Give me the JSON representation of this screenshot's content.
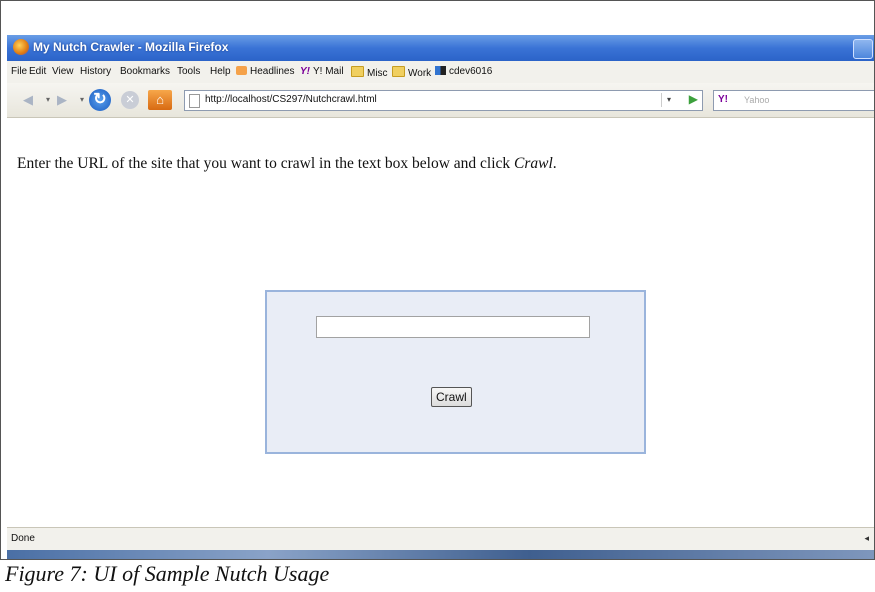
{
  "window": {
    "title": "My Nutch Crawler - Mozilla Firefox"
  },
  "menu": {
    "items": [
      {
        "label": "File"
      },
      {
        "label": "Edit"
      },
      {
        "label": "View"
      },
      {
        "label": "History"
      },
      {
        "label": "Bookmarks"
      },
      {
        "label": "Tools"
      },
      {
        "label": "Help"
      }
    ],
    "bookmarks": [
      {
        "label": "Headlines",
        "icon": "rss-icon"
      },
      {
        "label": "Y! Mail",
        "icon": "yahoo-mail-icon"
      },
      {
        "label": "Misc",
        "icon": "folder-icon"
      },
      {
        "label": "Work",
        "icon": "folder-icon"
      },
      {
        "label": "cdev6016",
        "icon": "delicious-icon"
      }
    ]
  },
  "navigation": {
    "url": "http://localhost/CS297/Nutchcrawl.html",
    "search_engine_label": "Y!",
    "search_placeholder": "Yahoo"
  },
  "page": {
    "instruction_before": "Enter the URL of the site that you want to crawl in the text box below and click ",
    "instruction_emphasis": "Crawl",
    "instruction_after": ".",
    "url_input_value": "",
    "crawl_button_label": "Crawl"
  },
  "status": {
    "text": "Done"
  },
  "caption": "Figure 7: UI of Sample Nutch Usage"
}
